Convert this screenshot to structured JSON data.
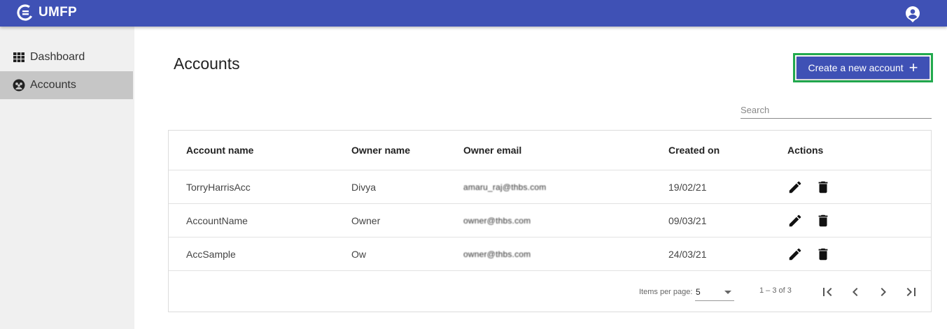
{
  "app": {
    "title": "UMFP"
  },
  "sidebar": {
    "items": [
      {
        "label": "Dashboard",
        "icon": "dashboard-icon",
        "active": false
      },
      {
        "label": "Accounts",
        "icon": "accounts-icon",
        "active": true
      }
    ]
  },
  "main": {
    "title": "Accounts",
    "create_button": {
      "label": "Create a new account",
      "icon": "plus-icon"
    },
    "search": {
      "placeholder": "Search",
      "value": ""
    }
  },
  "table": {
    "headers": [
      "Account name",
      "Owner name",
      "Owner email",
      "Created on",
      "Actions"
    ],
    "rows": [
      {
        "account_name": "TorryHarrisAcc",
        "owner_name": "Divya",
        "owner_email": "amaru_raj@thbs.com",
        "created_on": "19/02/21"
      },
      {
        "account_name": "AccountName",
        "owner_name": "Owner",
        "owner_email": "owner@thbs.com",
        "created_on": "09/03/21"
      },
      {
        "account_name": "AccSample",
        "owner_name": "Ow",
        "owner_email": "owner@thbs.com",
        "created_on": "24/03/21"
      }
    ],
    "row_actions": [
      "edit-icon",
      "delete-icon"
    ]
  },
  "paginator": {
    "items_per_page_label": "Items per page:",
    "page_size": "5",
    "range_label": "1 – 3 of 3"
  },
  "colors": {
    "primary": "#3f51b5",
    "highlight_border": "#22aa4e",
    "sidebar_bg": "#f0f0f0",
    "sidebar_active": "#c6c6c6"
  }
}
